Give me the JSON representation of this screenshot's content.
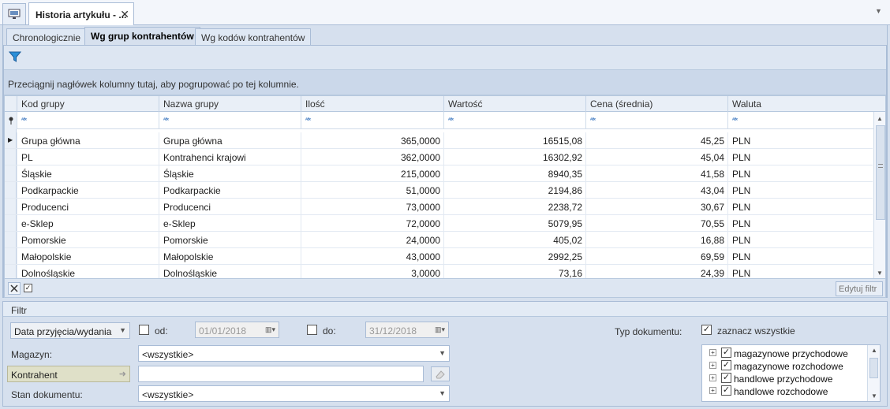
{
  "window": {
    "doc_tab_title": "Historia artykułu - ...",
    "close_glyph": "✕",
    "menu_glyph": "▼"
  },
  "tabs": [
    {
      "label": "Chronologicznie",
      "active": false
    },
    {
      "label": "Wg grup kontrahentów",
      "active": true
    },
    {
      "label": "Wg kodów kontrahentów",
      "active": false
    }
  ],
  "group_panel_text": "Przeciągnij nagłówek kolumny tutaj, aby pogrupować po tej kolumnie.",
  "grid": {
    "columns": [
      "Kod grupy",
      "Nazwa grupy",
      "Ilość",
      "Wartość",
      "Cena (średnia)",
      "Waluta"
    ],
    "filter_glyph": "ᴬᴮᶜ",
    "rows": [
      [
        "Grupa główna",
        "Grupa główna",
        "365,0000",
        "16515,08",
        "45,25",
        "PLN"
      ],
      [
        "PL",
        "Kontrahenci krajowi",
        "362,0000",
        "16302,92",
        "45,04",
        "PLN"
      ],
      [
        "Śląskie",
        "Śląskie",
        "215,0000",
        "8940,35",
        "41,58",
        "PLN"
      ],
      [
        "Podkarpackie",
        "Podkarpackie",
        "51,0000",
        "2194,86",
        "43,04",
        "PLN"
      ],
      [
        "Producenci",
        "Producenci",
        "73,0000",
        "2238,72",
        "30,67",
        "PLN"
      ],
      [
        "e-Sklep",
        "e-Sklep",
        "72,0000",
        "5079,95",
        "70,55",
        "PLN"
      ],
      [
        "Pomorskie",
        "Pomorskie",
        "24,0000",
        "405,02",
        "16,88",
        "PLN"
      ],
      [
        "Małopolskie",
        "Małopolskie",
        "43,0000",
        "2992,25",
        "69,59",
        "PLN"
      ],
      [
        "Dolnośląskie",
        "Dolnośląskie",
        "3,0000",
        "73,16",
        "24,39",
        "PLN"
      ]
    ]
  },
  "footer": {
    "edit_filter": "Edytuj filtr"
  },
  "filter": {
    "title": "Filtr",
    "date_type": "Data przyjęcia/wydania",
    "from_label": "od:",
    "from_value": "01/01/2018",
    "to_label": "do:",
    "to_value": "31/12/2018",
    "warehouse_label": "Magazyn:",
    "warehouse_value": "<wszystkie>",
    "contractor_label": "Kontrahent",
    "contractor_value": "",
    "status_label": "Stan dokumentu:",
    "status_value": "<wszystkie>",
    "doc_type_label": "Typ dokumentu:",
    "select_all_label": "zaznacz wszystkie",
    "doc_types": [
      "magazynowe przychodowe",
      "magazynowe rozchodowe",
      "handlowe przychodowe",
      "handlowe rozchodowe"
    ]
  },
  "colors": {
    "accent": "#1a5fb4",
    "header_bg": "#e9eff7",
    "panel_bg": "#d6e0ee"
  }
}
